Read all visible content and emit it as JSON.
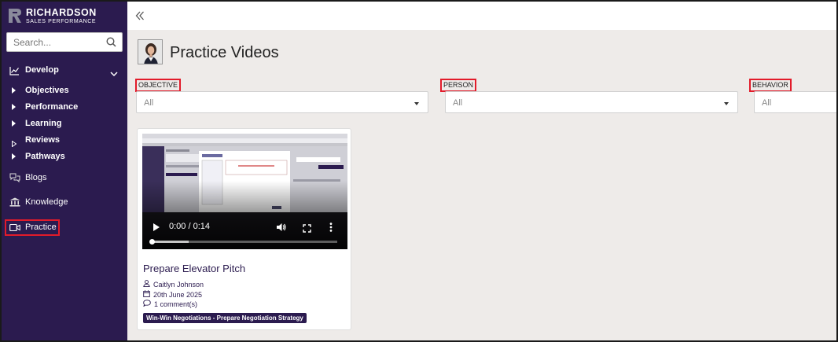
{
  "brand": {
    "name": "RICHARDSON",
    "tagline": "SALES PERFORMANCE"
  },
  "search": {
    "placeholder": "Search..."
  },
  "sidebar": {
    "develop": {
      "label": "Develop"
    },
    "sub_items": [
      {
        "label": "Objectives"
      },
      {
        "label": "Performance"
      },
      {
        "label": "Learning"
      },
      {
        "label": "Reviews"
      },
      {
        "label": "Pathways"
      }
    ],
    "items": [
      {
        "label": "Blogs",
        "icon": "chat-bubbles-icon"
      },
      {
        "label": "Knowledge",
        "icon": "bank-icon"
      },
      {
        "label": "Practice",
        "icon": "video-camera-icon"
      }
    ]
  },
  "page": {
    "title": "Practice Videos"
  },
  "filters": [
    {
      "label": "OBJECTIVE",
      "value": "All"
    },
    {
      "label": "PERSON",
      "value": "All"
    },
    {
      "label": "BEHAVIOR",
      "value": "All"
    }
  ],
  "card": {
    "title": "Prepare Elevator Pitch",
    "person": "Caitlyn Johnson",
    "date": "20th June 2025",
    "comments": "1 comment(s)",
    "tag": "Win-Win Negotiations - Prepare Negotiation Strategy",
    "video": {
      "time": "0:00 / 0:14",
      "progress": 0.2
    }
  },
  "colors": {
    "sidebar": "#2b1b4f",
    "highlight": "#e21b2a",
    "background": "#eeebe9"
  }
}
